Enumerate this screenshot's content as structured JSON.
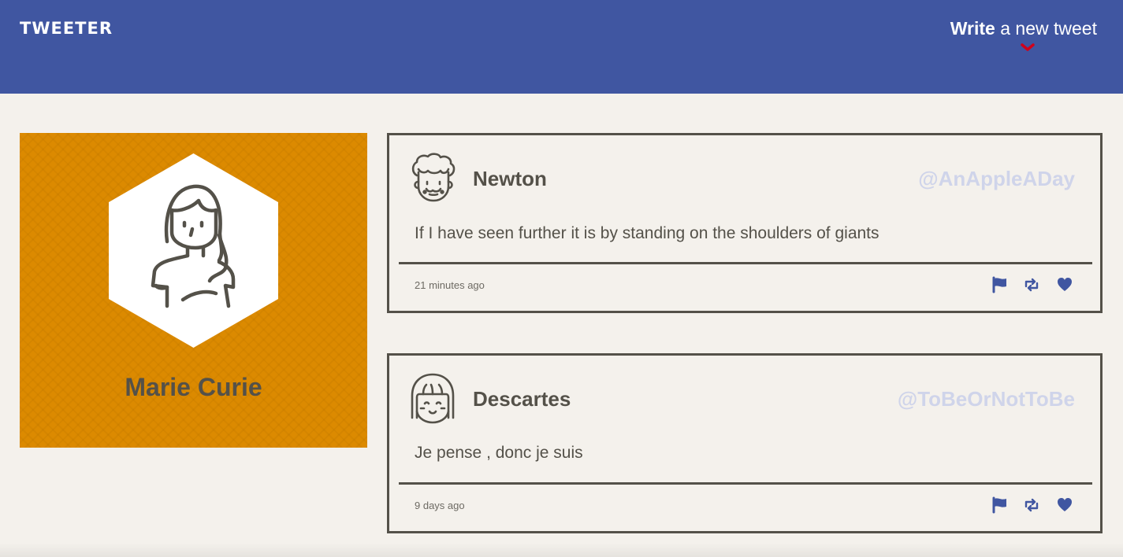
{
  "navbar": {
    "brand": "TWEETER",
    "compose_strong": "Write",
    "compose_rest": " a new tweet",
    "arrow_icon": "chevron-down-icon",
    "arrow_color": "#d0021b",
    "background": "#4056a1"
  },
  "profile": {
    "name": "Marie Curie",
    "avatar_icon": "woman-avatar-icon",
    "background": "#dc8a00"
  },
  "tweets": [
    {
      "name": "Newton",
      "handle": "@AnAppleADay",
      "text": "If I have seen further it is by standing on the shoulders of giants",
      "time": "21 minutes ago",
      "avatar_icon": "curly-hair-man-avatar-icon"
    },
    {
      "name": "Descartes",
      "handle": "@ToBeOrNotToBe",
      "text": "Je pense , donc je suis",
      "time": "9 days ago",
      "avatar_icon": "bob-hair-avatar-icon"
    }
  ],
  "actions": {
    "flag_icon": "flag-icon",
    "retweet_icon": "retweet-icon",
    "like_icon": "heart-icon",
    "color": "#4056a1"
  }
}
